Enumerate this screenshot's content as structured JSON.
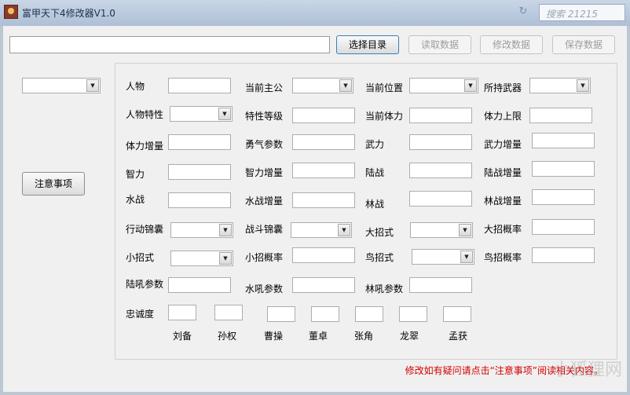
{
  "window": {
    "title": "富甲天下4修改器V1.0"
  },
  "search": {
    "text": "搜索 21215"
  },
  "toolbar": {
    "path_value": "",
    "select_dir": "选择目录",
    "read": "读取数据",
    "modify": "修改数据",
    "save": "保存数据"
  },
  "side": {
    "notice_button": "注意事项"
  },
  "fields": {
    "person": "人物",
    "lord": "当前主公",
    "position": "当前位置",
    "weapon": "所持武器",
    "trait": "人物特性",
    "trait_level": "特性等级",
    "cur_hp": "当前体力",
    "max_hp": "体力上限",
    "hp_gain": "体力增量",
    "courage": "勇气参数",
    "force": "武力",
    "force_gain": "武力增量",
    "intel": "智力",
    "intel_gain": "智力增量",
    "land": "陆战",
    "land_gain": "陆战增量",
    "water": "水战",
    "water_gain": "水战增量",
    "forest": "林战",
    "forest_gain": "林战增量",
    "move_kit": "行动锦囊",
    "battle_kit": "战斗锦囊",
    "big_move": "大招式",
    "big_prob": "大招概率",
    "small_move": "小招式",
    "small_prob": "小招概率",
    "bird_move": "鸟招式",
    "bird_prob": "鸟招概率",
    "land_roar": "陆吼参数",
    "water_roar": "水吼参数",
    "forest_roar": "林吼参数",
    "loyalty": "忠诚度"
  },
  "lords": [
    "刘备",
    "孙权",
    "曹操",
    "董卓",
    "张角",
    "龙翠",
    "孟获"
  ],
  "notice": "修改如有疑问请点击“注意事项”阅读相关内容。",
  "watermark": "小狐狸网"
}
